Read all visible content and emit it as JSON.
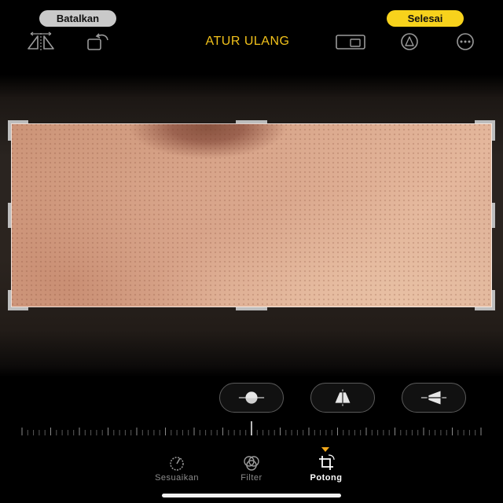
{
  "header": {
    "cancel_label": "Batalkan",
    "done_label": "Selesai",
    "reset_label": "ATUR ULANG"
  },
  "toolbar": {
    "icons": [
      "flip-icon",
      "rotate-icon",
      "aspect-ratio-icon",
      "markup-icon",
      "more-icon"
    ]
  },
  "adjust_buttons": {
    "icons": [
      "straighten-icon",
      "vertical-perspective-icon",
      "horizontal-perspective-icon"
    ]
  },
  "tabs": [
    {
      "label": "Sesuaikan",
      "icon": "adjust-dial-icon",
      "active": false
    },
    {
      "label": "Filter",
      "icon": "filter-circles-icon",
      "active": false
    },
    {
      "label": "Potong",
      "icon": "crop-rotate-icon",
      "active": true
    }
  ],
  "colors": {
    "accent_yellow": "#f7d21c",
    "reset_text": "#f2c21b",
    "tab_marker": "#f2a81b"
  }
}
